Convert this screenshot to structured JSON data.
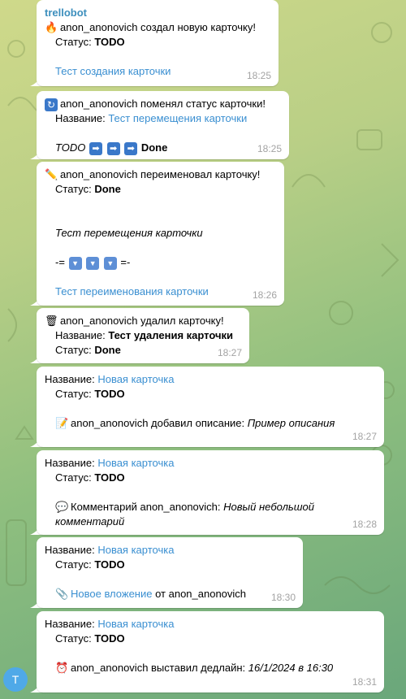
{
  "chat": {
    "avatar_letter": "T",
    "messages": [
      {
        "sender": "trellobot",
        "icon": "fire-icon",
        "author": "anon_anonovich",
        "text": " создал новую карточку!",
        "status_label": "Статус: ",
        "status_value": "TODO",
        "link": "Тест создания карточки",
        "time": "18:25"
      },
      {
        "icon": "cycle-icon",
        "author": "anon_anonovich",
        "text": " поменял статус карточки!",
        "name_label": "Название: ",
        "name_value": "Тест перемещения карточки",
        "from": "TODO",
        "to": "Done",
        "time": "18:25"
      },
      {
        "icon": "pencil-icon",
        "author": "anon_anonovich",
        "text": " переименовал карточку!",
        "status_label": "Статус: ",
        "status_value": "Done",
        "old_name": "Тест перемещения карточки",
        "sep_left": "-=",
        "sep_right": "=-",
        "new_name": "Тест переименования карточки",
        "time": "18:26"
      },
      {
        "icon": "trash-icon",
        "author": "anon_anonovich",
        "text": " удалил карточку!",
        "name_label": "Название: ",
        "name_value": "Тест удаления карточки",
        "status_label": "Статус: ",
        "status_value": "Done",
        "time": "18:27"
      },
      {
        "name_label": "Название: ",
        "name_value": "Новая карточка",
        "status_label": "Статус: ",
        "status_value": "TODO",
        "icon": "memo-icon",
        "action": "anon_anonovich добавил описание: ",
        "detail": "Пример описания",
        "time": "18:27"
      },
      {
        "name_label": "Название: ",
        "name_value": "Новая карточка",
        "status_label": "Статус: ",
        "status_value": "TODO",
        "icon": "speech-icon",
        "action": "Комментарий anon_anonovich: ",
        "detail_line1": "Новый небольшой",
        "detail_line2": "комментарий",
        "time": "18:28"
      },
      {
        "name_label": "Название: ",
        "name_value": "Новая карточка",
        "status_label": "Статус: ",
        "status_value": "TODO",
        "icon": "paperclip-icon",
        "link": "Новое вложение",
        "action": " от anon_anonovich",
        "time": "18:30"
      },
      {
        "name_label": "Название: ",
        "name_value": "Новая карточка",
        "status_label": "Статус: ",
        "status_value": "TODO",
        "icon": "alarm-clock-icon",
        "action": "anon_anonovich выставил дедлайн: ",
        "detail": "16/1/2024 в 16:30",
        "time": "18:31"
      }
    ]
  }
}
